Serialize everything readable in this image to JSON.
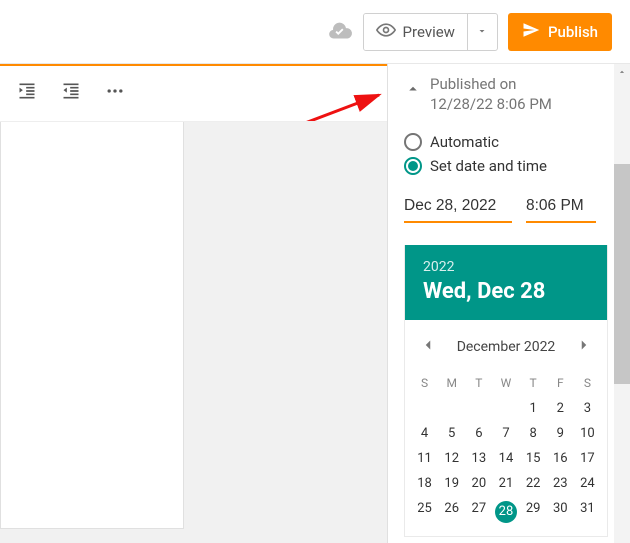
{
  "topbar": {
    "preview_label": "Preview",
    "publish_label": "Publish"
  },
  "panel": {
    "status_line1": "Published on",
    "status_line2": "12/28/22 8:06 PM",
    "option_auto": "Automatic",
    "option_set": "Set date and time",
    "date_value": "Dec 28, 2022",
    "time_value": "8:06 PM"
  },
  "calendar": {
    "year": "2022",
    "weekday_date": "Wed, Dec 28",
    "month_label": "December 2022",
    "dow": [
      "S",
      "M",
      "T",
      "W",
      "T",
      "F",
      "S"
    ],
    "leading_blanks": 4,
    "days_in_month": 31,
    "selected_day": 28
  },
  "icons": {
    "cloud": "cloud-done-icon",
    "eye": "eye-icon",
    "caret_down": "caret-down-icon",
    "chevron_up": "chevron-up-icon",
    "chevron_left": "chevron-left-icon",
    "chevron_right": "chevron-right-icon",
    "outdent": "outdent-icon",
    "indent": "indent-icon",
    "more": "more-icon",
    "send": "send-icon",
    "scroll_up": "scroll-up-icon"
  }
}
